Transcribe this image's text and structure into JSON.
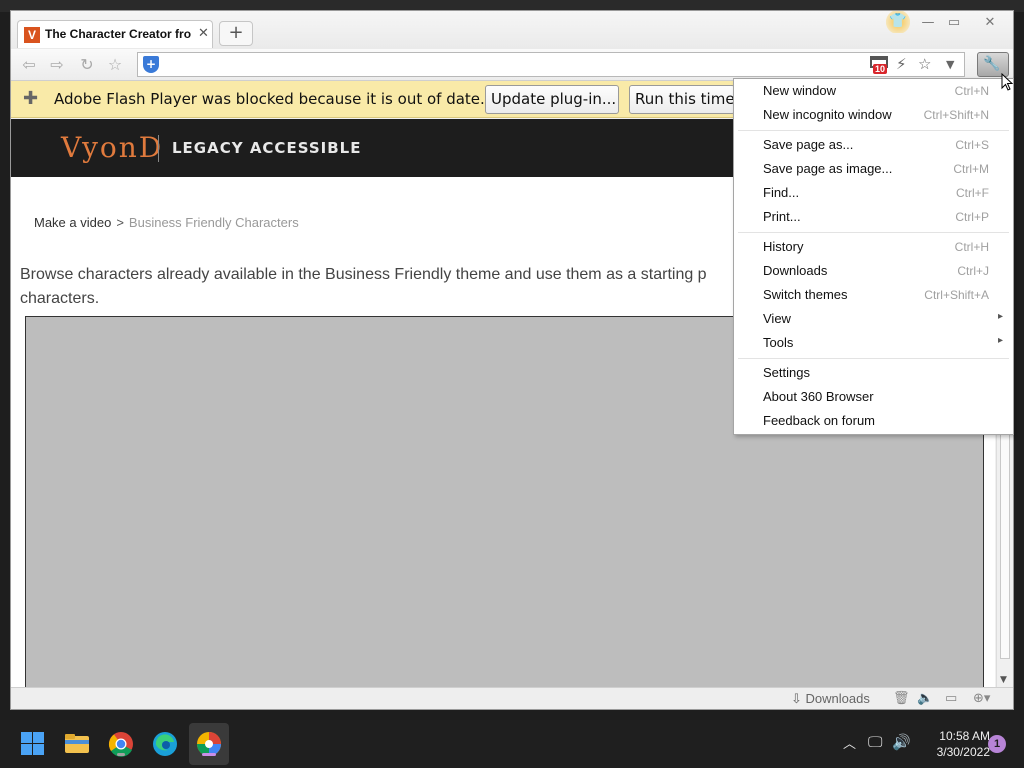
{
  "browser": {
    "tab_title": "The Character Creator fro",
    "tab_favicon": "V",
    "new_tab": "+",
    "address_badge": "10"
  },
  "flash_bar": {
    "message": "Adobe Flash Player was blocked because it is out of date.",
    "update_button": "Update plug-in...",
    "run_button": "Run this time"
  },
  "page": {
    "logo": "VyonD",
    "tagline": "LEGACY ACCESSIBLE",
    "breadcrumb": {
      "root": "Make a video",
      "separator": ">",
      "current": "Business Friendly Characters"
    },
    "intro_line1": "Browse characters already available in the Business Friendly theme and use them as a starting p",
    "intro_line2": "characters."
  },
  "statusbar": {
    "downloads": "Downloads"
  },
  "menu": {
    "items": [
      {
        "label": "New window",
        "shortcut": "Ctrl+N"
      },
      {
        "label": "New incognito window",
        "shortcut": "Ctrl+Shift+N"
      },
      {
        "label": "Save page as...",
        "shortcut": "Ctrl+S"
      },
      {
        "label": "Save page as image...",
        "shortcut": "Ctrl+M"
      },
      {
        "label": "Find...",
        "shortcut": "Ctrl+F"
      },
      {
        "label": "Print...",
        "shortcut": "Ctrl+P"
      },
      {
        "label": "History",
        "shortcut": "Ctrl+H"
      },
      {
        "label": "Downloads",
        "shortcut": "Ctrl+J"
      },
      {
        "label": "Switch themes",
        "shortcut": "Ctrl+Shift+A"
      },
      {
        "label": "View",
        "shortcut": ""
      },
      {
        "label": "Tools",
        "shortcut": ""
      },
      {
        "label": "Settings",
        "shortcut": ""
      },
      {
        "label": "About 360 Browser",
        "shortcut": ""
      },
      {
        "label": "Feedback on forum",
        "shortcut": ""
      }
    ]
  },
  "taskbar": {
    "time": "10:58 AM",
    "date": "3/30/2022",
    "notifications": "1"
  },
  "colors": {
    "flash_bar_bg": "#f9eaa8",
    "vyond_orange": "#e07a3d",
    "header_bg": "#1d1d1d",
    "placeholder_gray": "#bdbdbd"
  }
}
